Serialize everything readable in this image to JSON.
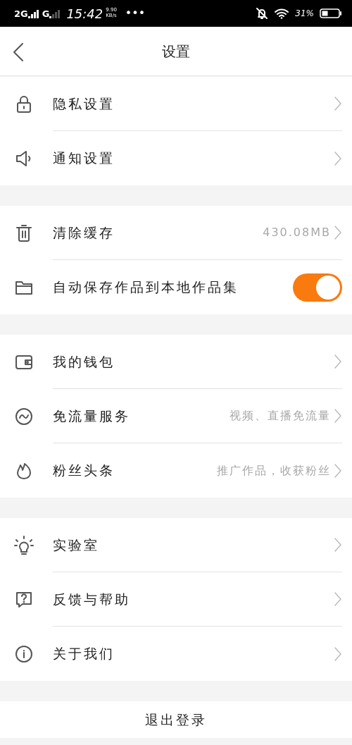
{
  "status_bar": {
    "network_1": "2G",
    "network_2": "G",
    "time": "15:42",
    "speed": "9.90",
    "speed_unit": "KB/s",
    "more": "•••",
    "battery": "31%"
  },
  "header": {
    "title": "设置"
  },
  "groups": [
    {
      "items": [
        {
          "kind": "link",
          "label": "隐私设置"
        },
        {
          "kind": "link",
          "label": "通知设置"
        }
      ]
    },
    {
      "items": [
        {
          "kind": "link",
          "label": "清除缓存",
          "value": "430.08MB"
        },
        {
          "kind": "toggle",
          "label": "自动保存作品到本地作品集",
          "on": true
        }
      ]
    },
    {
      "items": [
        {
          "kind": "link",
          "label": "我的钱包"
        },
        {
          "kind": "link",
          "label": "免流量服务",
          "value": "视频、直播免流量"
        },
        {
          "kind": "link",
          "label": "粉丝头条",
          "value": "推广作品，收获粉丝"
        }
      ]
    },
    {
      "items": [
        {
          "kind": "link",
          "label": "实验室"
        },
        {
          "kind": "link",
          "label": "反馈与帮助"
        },
        {
          "kind": "link",
          "label": "关于我们"
        }
      ]
    }
  ],
  "logout": {
    "label": "退出登录"
  }
}
